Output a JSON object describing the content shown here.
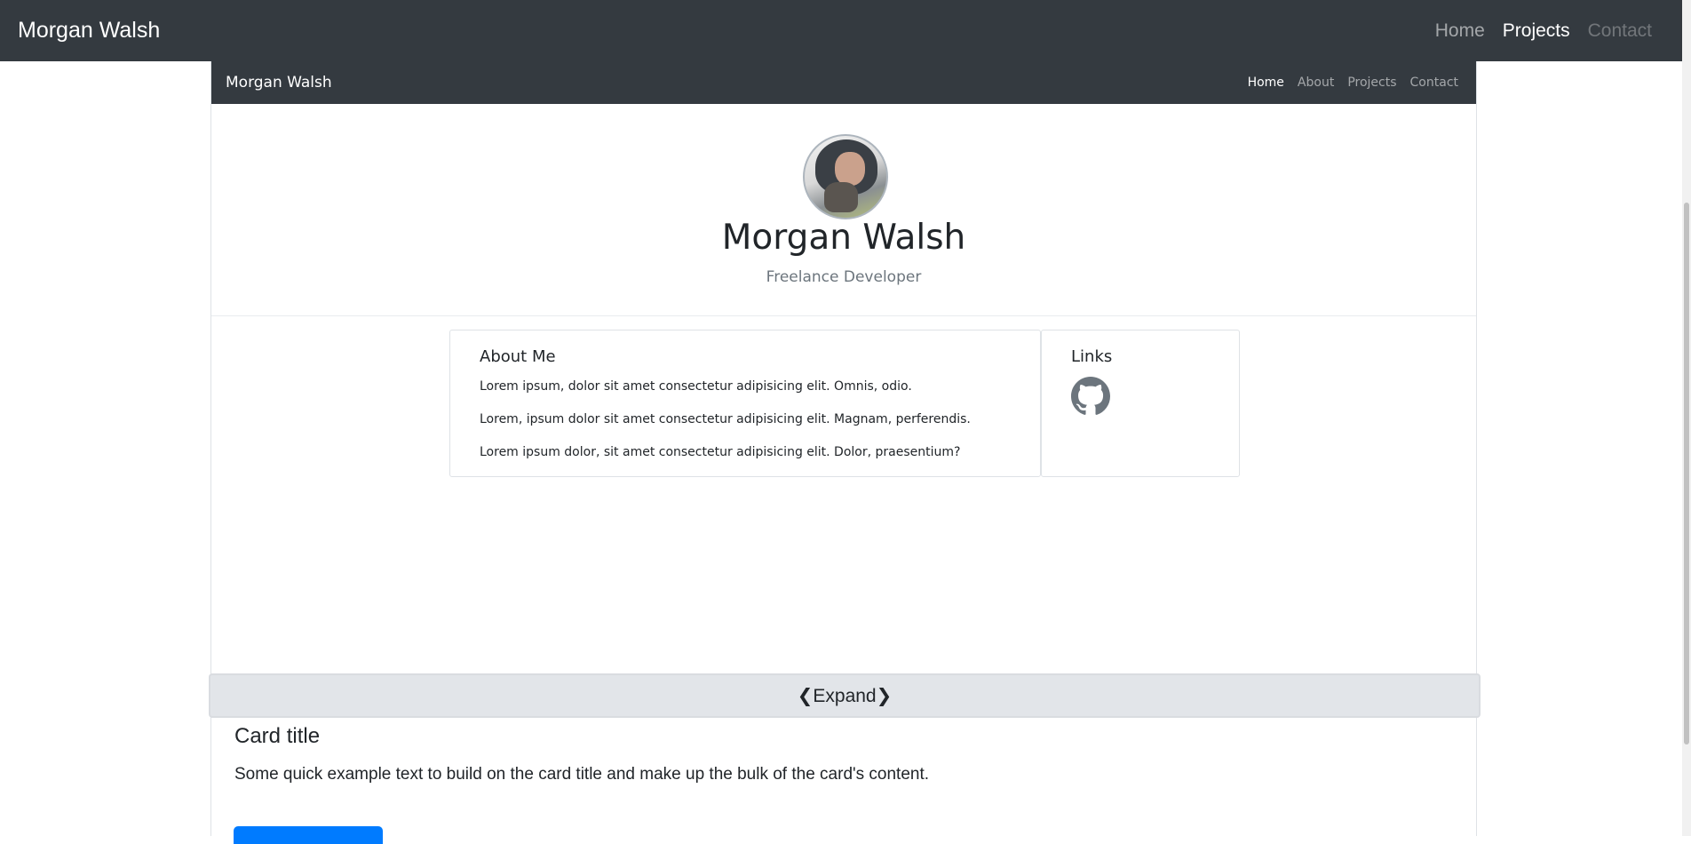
{
  "topbar": {
    "brand": "Morgan Walsh",
    "nav": [
      {
        "label": "Home"
      },
      {
        "label": "Projects"
      },
      {
        "label": "Contact"
      }
    ]
  },
  "preview": {
    "navbar": {
      "brand": "Morgan Walsh",
      "nav": [
        {
          "label": "Home"
        },
        {
          "label": "About"
        },
        {
          "label": "Projects"
        },
        {
          "label": "Contact"
        }
      ]
    },
    "hero": {
      "name": "Morgan Walsh",
      "role": "Freelance Developer"
    },
    "about": {
      "title": "About Me",
      "paragraphs": [
        "Lorem ipsum, dolor sit amet consectetur adipisicing elit. Omnis, odio.",
        "Lorem, ipsum dolor sit amet consectetur adipisicing elit. Magnam, perferendis.",
        "Lorem ipsum dolor, sit amet consectetur adipisicing elit. Dolor, praesentium?"
      ]
    },
    "links": {
      "title": "Links",
      "icon": "github-icon"
    }
  },
  "expand": {
    "label": "❮Expand❯"
  },
  "card": {
    "title": "Card title",
    "text": "Some quick example text to build on the card title and make up the bulk of the card's content."
  },
  "colors": {
    "navbar_bg": "#343a40",
    "expand_bg": "#e2e5e9",
    "primary_button": "#007bff"
  }
}
